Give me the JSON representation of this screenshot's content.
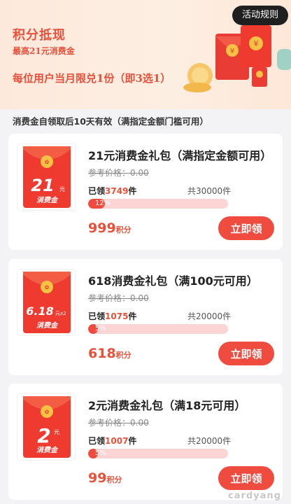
{
  "banner": {
    "title": "积分抵现",
    "subtitle": "最高21元消费金",
    "limit": "每位用户当月限兑1份（即3选1）",
    "rules_button": "活动规则"
  },
  "notice": "消费金自领取后10天有效（满指定金额门槛可用）",
  "cards": [
    {
      "thumb_amount": "21",
      "thumb_unit": "元",
      "thumb_label": "消费金",
      "title": "21元消费金礼包（满指定金额可用）",
      "ref_price": "参考价格：0.00",
      "claimed_prefix": "已领",
      "claimed_count": "3749",
      "claimed_suffix": "件",
      "total": "共30000件",
      "progress_text": "12%",
      "progress": 0.12,
      "points": "999",
      "points_unit": "积分",
      "claim_label": "立即领"
    },
    {
      "thumb_amount": "6.18",
      "thumb_unit": "元x2",
      "thumb_label": "消费金",
      "title": "618消费金礼包（满100元可用）",
      "ref_price": "参考价格：0.00",
      "claimed_prefix": "已领",
      "claimed_count": "1075",
      "claimed_suffix": "件",
      "total": "共20000件",
      "progress_text": "5%",
      "progress": 0.05,
      "points": "618",
      "points_unit": "积分",
      "claim_label": "立即领"
    },
    {
      "thumb_amount": "2",
      "thumb_unit": "元",
      "thumb_label": "消费金",
      "title": "2元消费金礼包（满18元可用）",
      "ref_price": "参考价格：0.00",
      "claimed_prefix": "已领",
      "claimed_count": "1007",
      "claimed_suffix": "件",
      "total": "共20000件",
      "progress_text": "5%",
      "progress": 0.05,
      "points": "99",
      "points_unit": "积分",
      "claim_label": "立即领"
    }
  ],
  "watermark": "cardyang",
  "colors": {
    "accent": "#ef4b3f",
    "banner_bg": "#fdeee2",
    "progress_track": "#fcd4d4"
  }
}
